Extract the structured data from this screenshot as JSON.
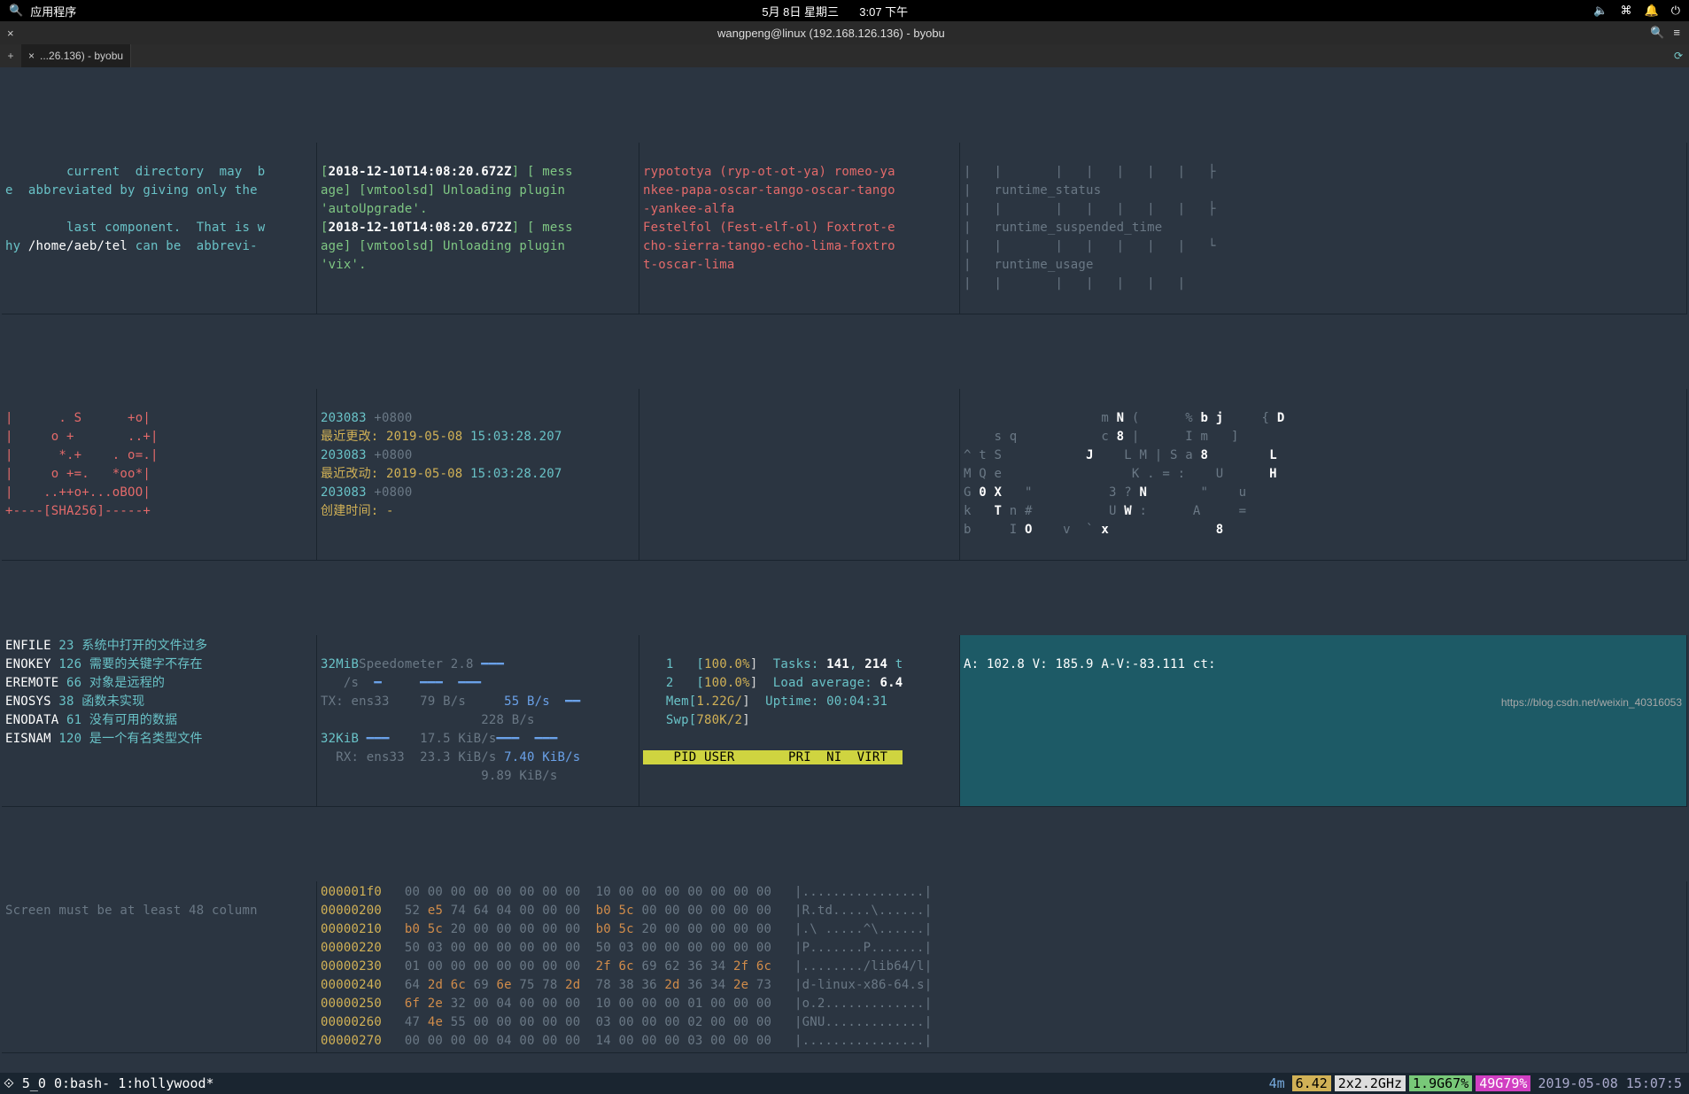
{
  "topbar": {
    "apps_label": "应用程序",
    "date": "5月 8日  星期三",
    "time": "3:07 下午"
  },
  "titlebar": {
    "title": "wangpeng@linux (192.168.126.136) - byobu"
  },
  "tabbar": {
    "tab_label": "...26.136) - byobu"
  },
  "pane_manpage": {
    "l1": "        current  directory  may  b",
    "l2_a": "e  abbreviated by giving only the ",
    "l3": "",
    "l4": "        last component.  That is w",
    "l5_a": "hy ",
    "l5_path": "/home/aeb/tel",
    "l5_b": " can be  abbrevi-"
  },
  "pane_log": {
    "l1_a": "[",
    "l1_ts": "2018-12-10T14:08:20.672Z",
    "l1_b": "] [ mess",
    "l2": "age] [vmtoolsd] Unloading plugin ",
    "l3": "'autoUpgrade'.",
    "l4_a": "[",
    "l4_ts": "2018-12-10T14:08:20.672Z",
    "l4_b": "] [ mess",
    "l5": "age] [vmtoolsd] Unloading plugin ",
    "l6": "'vix'."
  },
  "pane_phon": {
    "l1": "rypototya (ryp-ot-ot-ya) romeo-ya",
    "l2": "nkee-papa-oscar-tango-oscar-tango",
    "l3": "-yankee-alfa",
    "l4": "Festelfol (Fest-elf-ol) Foxtrot-e",
    "l5": "cho-sierra-tango-echo-lima-foxtro",
    "l6": "t-oscar-lima"
  },
  "pane_tree": {
    "l1": "|   |       |   |   |   |   |   ├",
    "l2": "|   runtime_status",
    "l3": "|   |       |   |   |   |   |   ├",
    "l4": "|   runtime_suspended_time",
    "l5": "|   |       |   |   |   |   |   └",
    "l6": "|   runtime_usage",
    "l7": "|   |       |   |   |   |   |"
  },
  "pane_sha": {
    "l1": "|      . S      +o|",
    "l2": "|     o +       ..+|",
    "l3": "|      *.+    . o=.|",
    "l4": "|     o +=.   *oo*|",
    "l5": "|    ..++o+...oBOO|",
    "l6": "+----[SHA256]-----+"
  },
  "pane_stat": {
    "l1_a": "203083",
    "l1_b": " +0800",
    "l2_a": "最近更改: 2019-05-08 ",
    "l2_b": "15:03:28.207",
    "l3_a": "203083",
    "l3_b": " +0800",
    "l4_a": "最近改动: 2019-05-08 ",
    "l4_b": "15:03:28.207",
    "l5_a": "203083",
    "l5_b": " +0800",
    "l6": "创建时间: -"
  },
  "pane_matrix": {
    "l1": "                  m ",
    "l1b": "N",
    "l1c": " (      % ",
    "l1d": "b j",
    "l1e": "     { ",
    "l1f": "D",
    "l2": "    s q           c ",
    "l2b": "8",
    "l2c": " |      I m   ]",
    "l3": "^ t S           ",
    "l3b": "J",
    "l3c": "    L M | S a ",
    "l3d": "8",
    "l3e": "        ",
    "l3f": "L",
    "l4": "M Q e                 K . = :    U      ",
    "l4b": "H",
    "l5": "G ",
    "l5b": "0 X",
    "l5c": "   \"          3 ? ",
    "l5d": "N",
    "l5e": "       \"    u",
    "l6": "k   ",
    "l6b": "T",
    "l6c": " n #          U ",
    "l6d": "W",
    "l6e": " :      A     =",
    "l7": "b     I ",
    "l7b": "O",
    "l7c": "    v  ` ",
    "l7d": "x",
    "l7e": "              ",
    "l7f": "8"
  },
  "pane_errno": {
    "lines": [
      [
        "ENFILE",
        " 23 系统中打开的文件过多"
      ],
      [
        "ENOKEY",
        " 126 需要的关键字不存在"
      ],
      [
        "EREMOTE",
        " 66 对象是远程的"
      ],
      [
        "ENOSYS",
        " 38 函数未实现"
      ],
      [
        "ENODATA",
        " 61 没有可用的数据"
      ],
      [
        "EISNAM",
        " 120 是一个有名类型文件"
      ]
    ]
  },
  "pane_speed": {
    "l1_a": "32MiB",
    "l1_b": "Speedometer 2.8 ",
    "l2": "   /s  ",
    "l3_a": "TX: ens33",
    "l3_b": "    79 B/s",
    "l3_c": "     55 B/s",
    "l4": "                     228 B/s",
    "l5_a": "32KiB ",
    "l5_b": "    17.5 KiB/s",
    "l6_a": "  RX: ens33  23.3 KiB/s ",
    "l6_b": "7.40 KiB/s",
    "l7": "                     9.89 KiB/s"
  },
  "pane_htop": {
    "cpu1": "   1   [",
    "cpu1_v": "100.0%",
    "cpu2": "   2   [",
    "cpu2_v": "100.0%",
    "mem": "   Mem[",
    "mem_v": "1.22G/",
    "swp": "   Swp[",
    "swp_v": "780K/2",
    "tasks_l": "  Tasks: ",
    "tasks_a": "141",
    "tasks_b": ", ",
    "tasks_c": "214",
    "tasks_d": " t",
    "load_l": "  Load average: ",
    "load_v": "6.4",
    "up_l": "  Uptime: ",
    "up_v": "00:04:31",
    "header": "    PID USER       PRI  NI  VIRT  "
  },
  "pane_av": {
    "l1": "A: 102.8 V: 185.9 A-V:-83.111 ct:"
  },
  "pane_screen": {
    "l1": "Screen must be at least 48 column"
  },
  "pane_hex": {
    "rows": [
      {
        "addr": "000001f0",
        "l": "   00 00 00 00 00 00 00 00",
        "r": "  10 00 00 00 00 00 00 00",
        "t": "   |................|"
      },
      {
        "addr": "00000200",
        "l": "   52 ",
        "lh": "e5",
        "l2": " 74 64 04 00 00 00",
        "r": "  ",
        "rh": "b0 5c",
        "r2": " 00 00 00 00 00 00",
        "t": "   |R.td.....\\......|"
      },
      {
        "addr": "00000210",
        "l": "   ",
        "lh": "b0 5c",
        "l2": " 20 00 00 00 00 00",
        "r": "  ",
        "rh": "b0 5c",
        "r2": " 20 00 00 00 00 00",
        "t": "   |.\\ .....^\\......|"
      },
      {
        "addr": "00000220",
        "l": "   50 03 00 00 00 00 00 00",
        "r": "  50 03 00 00 00 00 00 00",
        "t": "   |P.......P.......|"
      },
      {
        "addr": "00000230",
        "l": "   01 00 00 00 00 00 00 00",
        "r": "  ",
        "rh": "2f 6c",
        "r2": " 69 62 36 34 ",
        "rh2": "2f 6c",
        "t": "   |......../lib64/l|"
      },
      {
        "addr": "00000240",
        "l": "   64 ",
        "lh": "2d 6c",
        "l2": " 69 ",
        "lh2": "6e",
        "l3": " 75 78 ",
        "lh3": "2d",
        "r": "  78 38 36 ",
        "rh": "2d",
        "r2": " 36 34 ",
        "rh2": "2e",
        "r3": " 73",
        "t": "   |d-linux-x86-64.s|"
      },
      {
        "addr": "00000250",
        "l": "   ",
        "lh": "6f 2e",
        "l2": " 32 00 04 00 00 00",
        "r": "  10 00 00 00 01 00 00 00",
        "t": "   |o.2.............|"
      },
      {
        "addr": "00000260",
        "l": "   47 ",
        "lh": "4e",
        "l2": " 55 00 00 00 00 00",
        "r": "  03 00 00 00 02 00 00 00",
        "t": "   |GNU.............|"
      },
      {
        "addr": "00000270",
        "l": "   00 00 00 00 04 00 00 00",
        "r": "  14 00 00 00 03 00 00 00",
        "t": "   |................|"
      }
    ]
  },
  "statusbar": {
    "left": "⟐ 5_0 0:bash- 1:hollywood*",
    "seg1": "4m",
    "seg2": "6.42",
    "seg3": "2x2.2GHz",
    "seg4": "1.9G67%",
    "seg5": "49G79%",
    "seg6": "2019-05-08 15:07:5"
  },
  "watermark": "https://blog.csdn.net/weixin_40316053"
}
